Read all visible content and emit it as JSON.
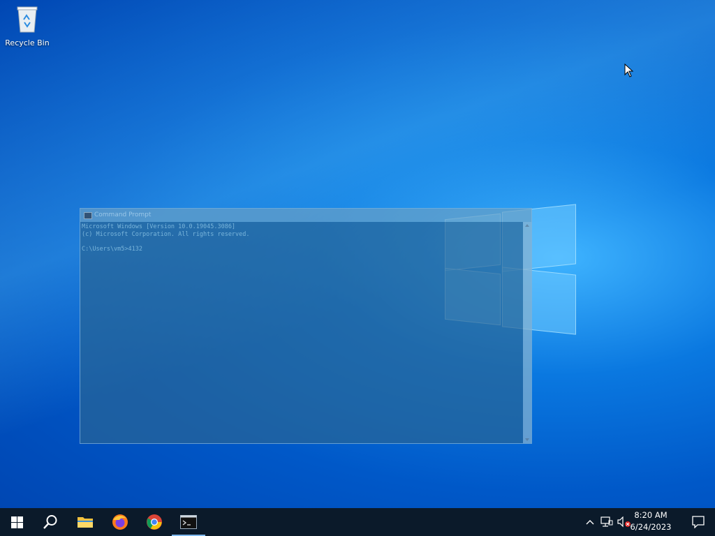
{
  "desktop": {
    "icons": [
      {
        "label": "Recycle Bin",
        "icon": "recycle-bin-icon"
      }
    ]
  },
  "cmd_window": {
    "title": "Command Prompt",
    "lines": [
      "Microsoft Windows [Version 10.0.19045.3086]",
      "(c) Microsoft Corporation. All rights reserved.",
      "",
      "C:\\Users\\vm5>4132"
    ]
  },
  "taskbar": {
    "apps": [
      {
        "name": "start",
        "icon": "windows-start-icon"
      },
      {
        "name": "search",
        "icon": "search-icon"
      },
      {
        "name": "file-explorer",
        "icon": "folder-icon"
      },
      {
        "name": "firefox",
        "icon": "firefox-icon"
      },
      {
        "name": "chrome",
        "icon": "chrome-icon"
      },
      {
        "name": "command-prompt",
        "icon": "terminal-icon",
        "active": true
      }
    ],
    "tray_icons": [
      "chevron-up-icon",
      "network-icon",
      "volume-muted-icon"
    ],
    "clock": {
      "time": "8:20 AM",
      "date": "6/24/2023"
    },
    "notification_icon": "action-center-icon"
  },
  "colors": {
    "accent": "#0a78e0",
    "taskbar": "#0b1a2a"
  }
}
